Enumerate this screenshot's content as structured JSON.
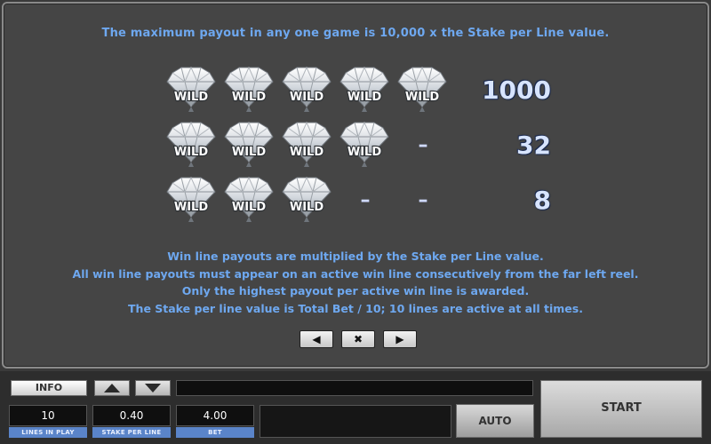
{
  "paytable": {
    "headline": "The maximum payout in any one game is 10,000 x the Stake per Line value.",
    "symbol_name": "wild-diamond-icon",
    "symbol_text": "WILD",
    "dash": "–",
    "rows": [
      {
        "count": 5,
        "amount": "1000"
      },
      {
        "count": 4,
        "amount": "32"
      },
      {
        "count": 3,
        "amount": "8"
      }
    ],
    "rules": [
      "Win line payouts are multiplied by the Stake per Line value.",
      "All win line payouts must appear on an active win line consecutively from the far left reel.",
      "Only the highest payout per active win line is awarded.",
      "The Stake per line value is Total Bet / 10; 10 lines are active at all times."
    ],
    "nav": {
      "prev_icon": "◀",
      "close_icon": "✖",
      "next_icon": "▶"
    }
  },
  "controls": {
    "info_label": "INFO",
    "lines_value": "10",
    "lines_label": "LINES IN PLAY",
    "stake_value": "0.40",
    "stake_label": "STAKE PER LINE",
    "bet_value": "4.00",
    "bet_label": "BET",
    "auto_label": "AUTO",
    "start_label": "START"
  }
}
